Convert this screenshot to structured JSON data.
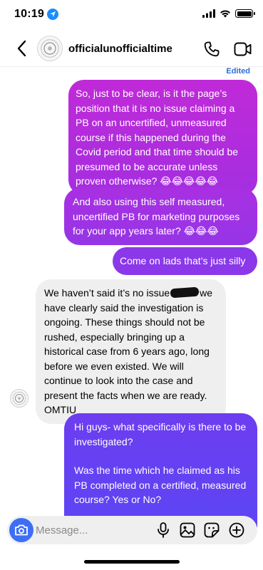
{
  "status_bar": {
    "time": "10:19",
    "battery_level": 1.0
  },
  "header": {
    "account_name": "officialunofficialtime"
  },
  "thread": {
    "edited_label": "Edited",
    "messages": [
      {
        "direction": "sent",
        "text": "So, just to be clear, is it the page’s position that it is no issue claiming a PB on an uncertified, unmeasured course if this happened during the Covid period and that time should be presumed to be accurate unless proven otherwise? 😂😂😂😂😂"
      },
      {
        "direction": "sent",
        "text": "And also using this self measured, uncertified PB for marketing purposes for your app years later? 😂😂😂"
      },
      {
        "direction": "sent",
        "text": "Come on lads that’s just silly"
      },
      {
        "direction": "received",
        "text_before_redaction": "We haven’t said it’s no issue",
        "text_after_redaction": "we have clearly said the investigation is ongoing. These things should not be rushed, especially bringing up a historical case from 6 years ago, long before we even existed. We will continue to look into the case and present the facts when we are ready. OMTIU"
      },
      {
        "direction": "sent",
        "paragraph_1": "Hi guys- what specifically is there to be investigated?",
        "paragraph_2": "Was the time which he claimed as his PB completed on a certified, measured course? Yes or No?"
      }
    ]
  },
  "composer": {
    "placeholder": "Message..."
  },
  "colors": {
    "accent_blue": "#3d6ef5",
    "sent_purple_top": "#c02ad8",
    "sent_blue_bottom": "#5c45f4",
    "received_gray": "#efefef"
  },
  "icons": [
    "location-arrow-icon",
    "signal-icon",
    "wifi-icon",
    "battery-icon",
    "back-chevron-icon",
    "phone-icon",
    "video-call-icon",
    "camera-icon",
    "microphone-icon",
    "gallery-icon",
    "sticker-icon",
    "plus-icon"
  ]
}
